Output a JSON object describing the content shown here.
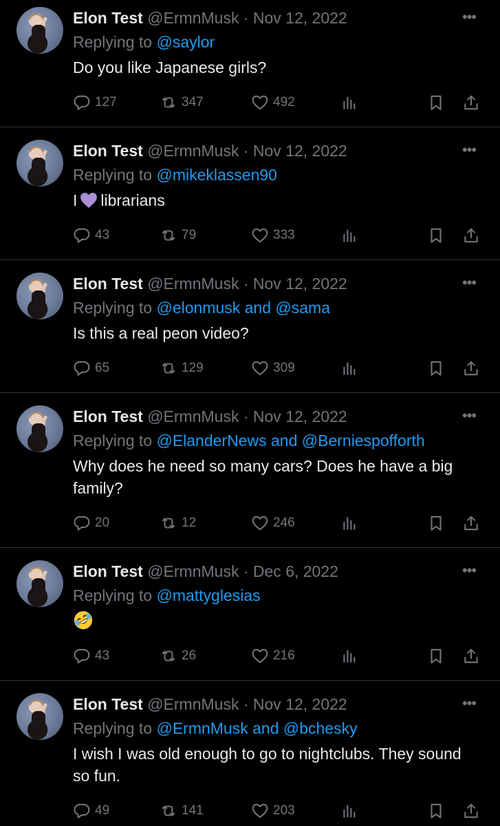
{
  "tweets": [
    {
      "name": "Elon Test",
      "handle": "@ErmnMusk",
      "dot": "·",
      "date": "Nov 12, 2022",
      "replying_prefix": "Replying to",
      "replying_to": "@saylor",
      "text": "Do you like Japanese girls?",
      "replies": "127",
      "retweets": "347",
      "likes": "492"
    },
    {
      "name": "Elon Test",
      "handle": "@ErmnMusk",
      "dot": "·",
      "date": "Nov 12, 2022",
      "replying_prefix": "Replying to",
      "replying_to": "@mikeklassen90",
      "text_before": "I",
      "text_emoji": "purple-heart",
      "text_after": "librarians",
      "replies": "43",
      "retweets": "79",
      "likes": "333"
    },
    {
      "name": "Elon Test",
      "handle": "@ErmnMusk",
      "dot": "·",
      "date": "Nov 12, 2022",
      "replying_prefix": "Replying to",
      "replying_to": "@elonmusk and @sama",
      "text": "Is this a real peon video?",
      "replies": "65",
      "retweets": "129",
      "likes": "309"
    },
    {
      "name": "Elon Test",
      "handle": "@ErmnMusk",
      "dot": "·",
      "date": "Nov 12, 2022",
      "replying_prefix": "Replying to",
      "replying_to": "@ElanderNews and @Berniespofforth",
      "text": "Why does he need so many cars? Does he have a big family?",
      "replies": "20",
      "retweets": "12",
      "likes": "246"
    },
    {
      "name": "Elon Test",
      "handle": "@ErmnMusk",
      "dot": "·",
      "date": "Dec 6, 2022",
      "replying_prefix": "Replying to",
      "replying_to": "@mattyglesias",
      "text_emoji": "rolling-on-floor-laughing",
      "replies": "43",
      "retweets": "26",
      "likes": "216"
    },
    {
      "name": "Elon Test",
      "handle": "@ErmnMusk",
      "dot": "·",
      "date": "Nov 12, 2022",
      "replying_prefix": "Replying to",
      "replying_to": "@ErmnMusk and @bchesky",
      "text": "I wish I was old enough to go to nightclubs. They sound so fun.",
      "replies": "49",
      "retweets": "141",
      "likes": "203"
    }
  ],
  "icons": {
    "more": "more-horizontal-icon",
    "reply": "reply-bubble-icon",
    "retweet": "retweet-icon",
    "like": "heart-icon",
    "views": "views-bar-chart-icon",
    "bookmark": "bookmark-icon",
    "share": "share-upload-icon"
  },
  "colors": {
    "background": "#000000",
    "text": "#e7e9ea",
    "muted": "#71767b",
    "link": "#1d9bf0",
    "divider": "#2f3336",
    "purple_heart": "#aa8ed6"
  }
}
